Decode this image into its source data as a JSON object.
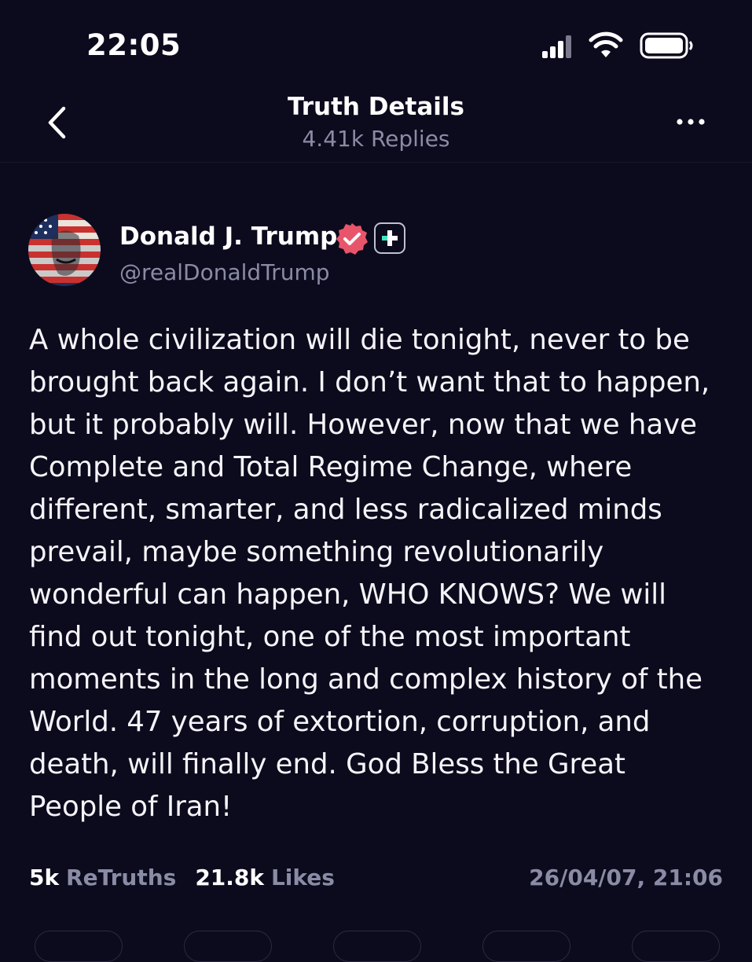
{
  "status_bar": {
    "time": "22:05",
    "icons": [
      "cellular-signal-icon",
      "wifi-icon",
      "battery-icon"
    ]
  },
  "header": {
    "title": "Truth Details",
    "subtitle": "4.41k Replies",
    "icons": [
      "chevron-left-icon",
      "more-horizontal-icon"
    ]
  },
  "post": {
    "author_name": "Donald J. Trump",
    "author_handle": "@realDonaldTrump",
    "badges": [
      "verified-badge-icon",
      "plus-badge-icon"
    ],
    "text": "A whole civilization will die tonight, never to be\nbrought back again. I don’t want that to happen,\nbut it probably will. However, now that we have\nComplete and Total Regime Change, where\ndifferent, smarter, and less radicalized minds\nprevail, maybe something revolutionarily\nwonderful can happen, WHO KNOWS? We will\nfind out tonight, one of the most important\nmoments in the long and complex history of the\nWorld. 47 years of extortion, corruption, and\ndeath, will finally end. God Bless the Great\nPeople of Iran!",
    "stats": {
      "retruths_count": "5k",
      "retruths_label": "ReTruths",
      "likes_count": "21.8k",
      "likes_label": "Likes"
    },
    "date": "26/04/07, 21:06"
  },
  "colors": {
    "background": "#0c0b1d",
    "text_primary": "#ffffff",
    "text_secondary": "#8a8ba5",
    "verified_badge": "#e8556b",
    "plus_badge_accent": "#3ee6c0"
  }
}
